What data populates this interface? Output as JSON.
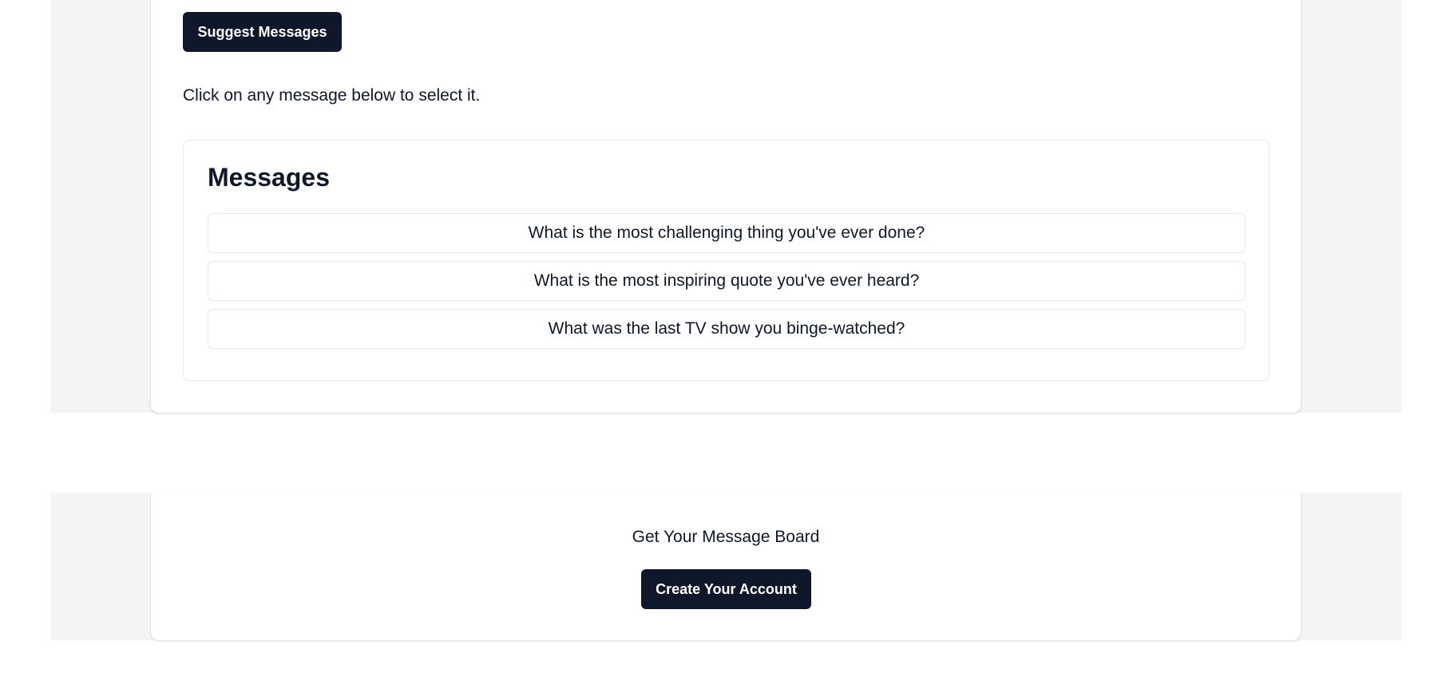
{
  "toolbar": {
    "suggest_label": "Suggest Messages"
  },
  "hint_text": "Click on any message below to select it.",
  "messages": {
    "title": "Messages",
    "items": [
      "What is the most challenging thing you've ever done?",
      "What is the most inspiring quote you've ever heard?",
      "What was the last TV show you binge-watched?"
    ]
  },
  "footer": {
    "headline": "Get Your Message Board",
    "cta_label": "Create Your Account"
  },
  "colors": {
    "primary": "#0f172a",
    "band": "#f3f4f6",
    "border": "#e5e7eb"
  }
}
